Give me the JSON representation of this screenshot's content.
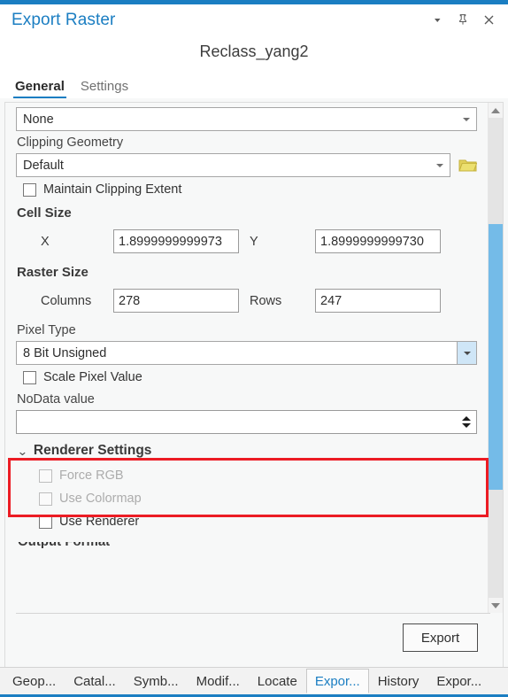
{
  "window": {
    "title": "Export Raster",
    "icons": {
      "menu": "chevron-down-icon",
      "pin": "pin-icon",
      "close": "close-icon"
    }
  },
  "document_title": "Reclass_yang2",
  "tabs": [
    {
      "label": "General",
      "active": true
    },
    {
      "label": "Settings",
      "active": false
    }
  ],
  "form": {
    "clipping_dropdown_value": "None",
    "clipping_geometry_label": "Clipping Geometry",
    "clipping_geometry_value": "Default",
    "folder_icon": "folder-open-icon",
    "maintain_clipping_extent": {
      "label": "Maintain Clipping Extent",
      "checked": false
    },
    "cell_size": {
      "heading": "Cell Size",
      "x_label": "X",
      "x_value": "1.8999999999973",
      "y_label": "Y",
      "y_value": "1.8999999999730"
    },
    "raster_size": {
      "heading": "Raster Size",
      "columns_label": "Columns",
      "columns_value": "278",
      "rows_label": "Rows",
      "rows_value": "247"
    },
    "pixel_type": {
      "label": "Pixel Type",
      "value": "8 Bit Unsigned",
      "highlighted": true,
      "highlight_color": "#ec1c24"
    },
    "scale_pixel_value": {
      "label": "Scale Pixel Value",
      "checked": false
    },
    "nodata": {
      "label": "NoData value",
      "value": ""
    },
    "renderer_settings": {
      "heading": "Renderer Settings",
      "expanded": true,
      "options": [
        {
          "label": "Force RGB",
          "checked": false,
          "disabled": true
        },
        {
          "label": "Use Colormap",
          "checked": false,
          "disabled": true
        },
        {
          "label": "Use Renderer",
          "checked": false,
          "disabled": false
        }
      ]
    },
    "output_format_heading": "Output Format"
  },
  "footer": {
    "export_label": "Export"
  },
  "dock_tabs": [
    {
      "label": "Geop...",
      "active": false
    },
    {
      "label": "Catal...",
      "active": false
    },
    {
      "label": "Symb...",
      "active": false
    },
    {
      "label": "Modif...",
      "active": false
    },
    {
      "label": "Locate",
      "active": false
    },
    {
      "label": "Expor...",
      "active": true
    },
    {
      "label": "History",
      "active": false
    },
    {
      "label": "Expor...",
      "active": false
    }
  ],
  "colors": {
    "accent": "#1b7ec2",
    "scrollbar_thumb": "#74bbe8",
    "highlight": "#ec1c24",
    "folder": "#d8c84a"
  }
}
